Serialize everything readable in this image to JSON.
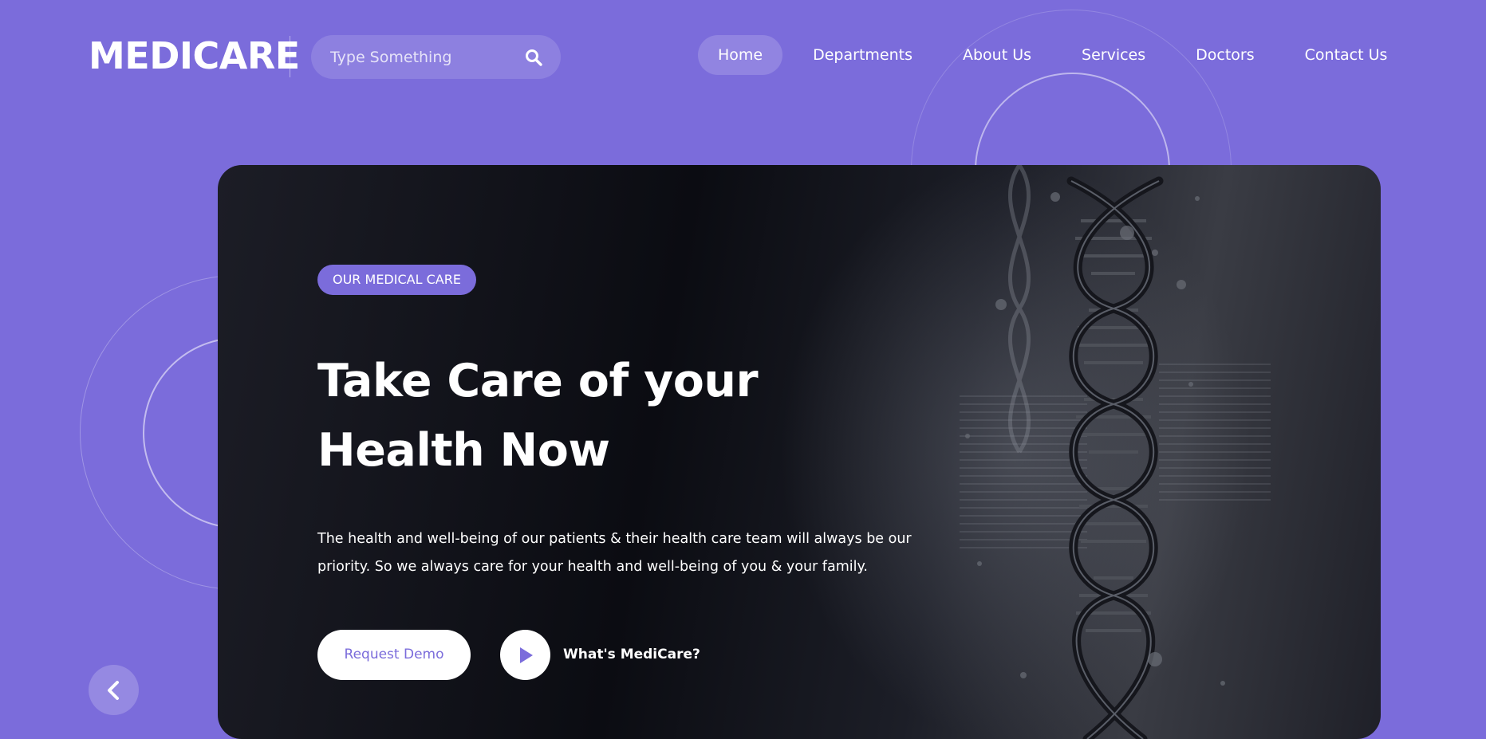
{
  "brand": {
    "logo_text": "MEDICARE"
  },
  "search": {
    "placeholder": "Type Something",
    "value": "",
    "icon": "search-icon"
  },
  "nav": {
    "items": [
      {
        "label": "Home",
        "active": true
      },
      {
        "label": "Departments",
        "active": false
      },
      {
        "label": "About Us",
        "active": false
      },
      {
        "label": "Services",
        "active": false
      },
      {
        "label": "Doctors",
        "active": false
      },
      {
        "label": "Contact Us",
        "active": false
      }
    ]
  },
  "hero": {
    "tag": "OUR MEDICAL CARE",
    "title_line1": "Take Care of your",
    "title_line2": "Health Now",
    "description_line1": "The health and well-being of our patients & their health care team will always be our",
    "description_line2": "priority. So we always care for your health and well-being of you & your family.",
    "primary_button": "Request Demo",
    "video_link": "What's MediCare?",
    "video_icon": "play-icon"
  },
  "slider": {
    "prev_icon": "chevron-left-icon"
  },
  "colors": {
    "brand": "#7b6cdb",
    "hero_background": "#0b0c12",
    "text": "#ffffff"
  }
}
